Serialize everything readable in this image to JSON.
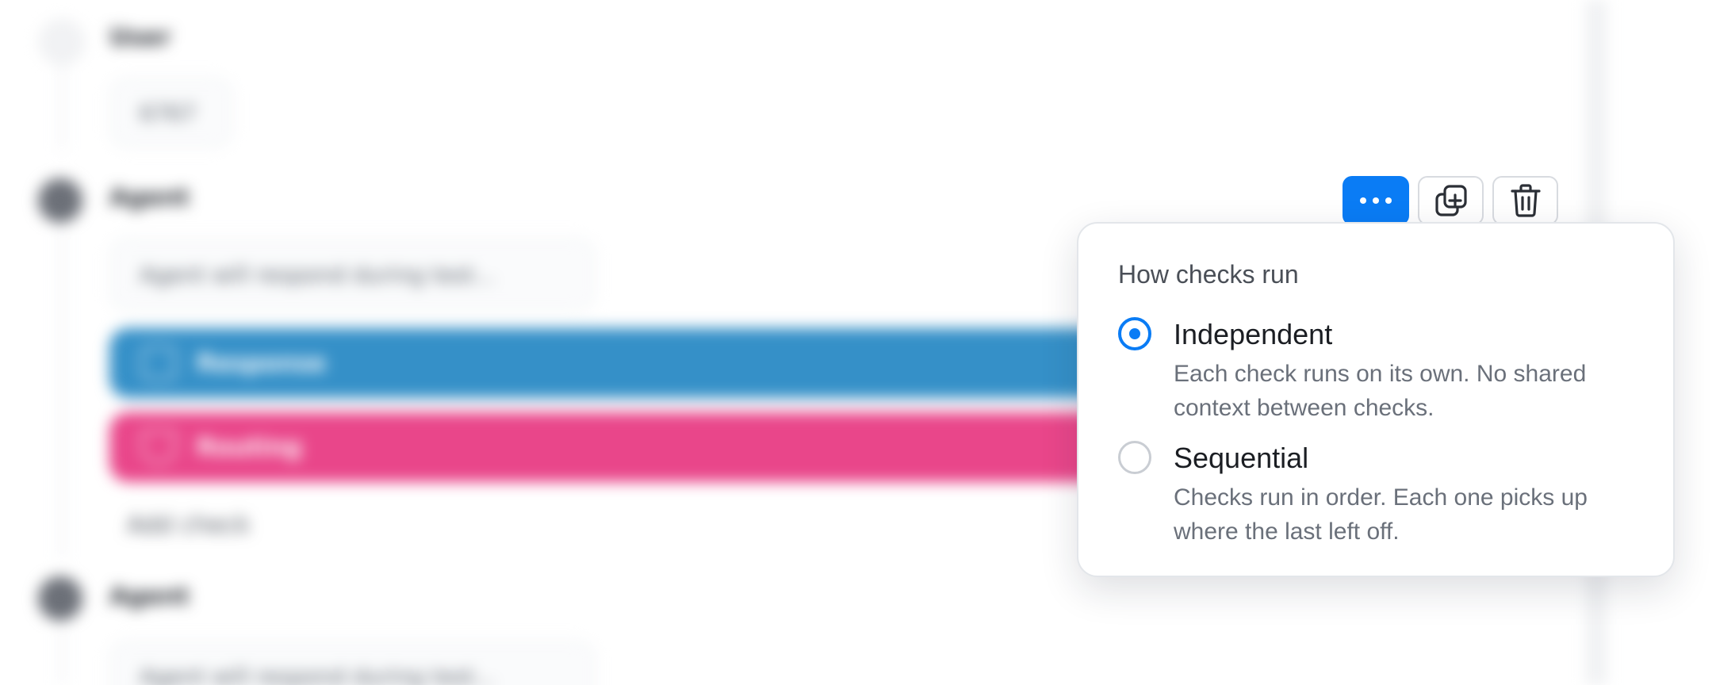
{
  "background": {
    "rows": [
      {
        "role": "User",
        "message": "6767",
        "icon": "user-icon"
      },
      {
        "role": "Agent",
        "message": "Agent will respond during test...",
        "icon": "agent-icon"
      },
      {
        "role": "Agent",
        "message": "Agent will respond during test...",
        "icon": "agent-icon"
      }
    ],
    "checks": [
      {
        "label": "Response",
        "color": "#3590c8",
        "icon": "response-icon"
      },
      {
        "label": "Routing",
        "color": "#e9468a",
        "icon": "routing-icon"
      }
    ],
    "add_check_label": "Add check"
  },
  "toolbar": {
    "more_icon": "more-options-icon",
    "duplicate_icon": "duplicate-icon",
    "delete_icon": "trash-icon",
    "accent": "#0a7cf5"
  },
  "popover": {
    "title": "How checks run",
    "options": [
      {
        "label": "Independent",
        "description": "Each check runs on its own. No shared context between checks.",
        "selected": true
      },
      {
        "label": "Sequential",
        "description": "Checks run in order. Each one picks up where the last left off.",
        "selected": false
      }
    ]
  }
}
